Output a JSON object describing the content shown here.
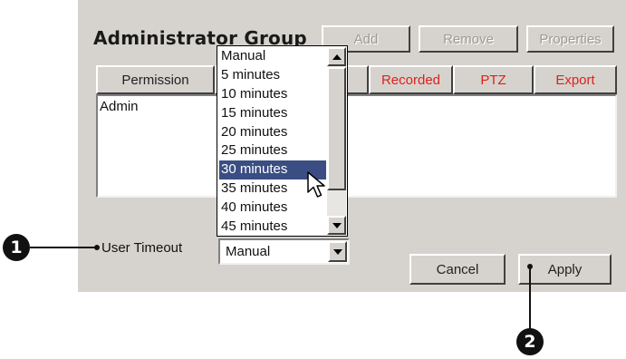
{
  "dialog": {
    "title": "Administrator Group",
    "buttons": {
      "add": "Add",
      "remove": "Remove",
      "properties": "Properties"
    },
    "columns": {
      "permission": "Permission",
      "recorded": "Recorded",
      "ptz": "PTZ",
      "export": "Export"
    },
    "list_items": [
      "Admin"
    ],
    "user_timeout": {
      "label": "User Timeout",
      "value": "Manual",
      "options": [
        "Manual",
        "5  minutes",
        "10 minutes",
        "15 minutes",
        "20 minutes",
        "25 minutes",
        "30 minutes",
        "35 minutes",
        "40 minutes",
        "45 minutes"
      ],
      "highlighted": "30 minutes"
    },
    "cancel": "Cancel",
    "apply": "Apply"
  },
  "callouts": [
    "1",
    "2"
  ],
  "colors": {
    "dialog_bg": "#d6d3ce",
    "highlight": "#3b4e83",
    "red_text": "#e0201a",
    "disabled_text": "#9d9a95"
  }
}
